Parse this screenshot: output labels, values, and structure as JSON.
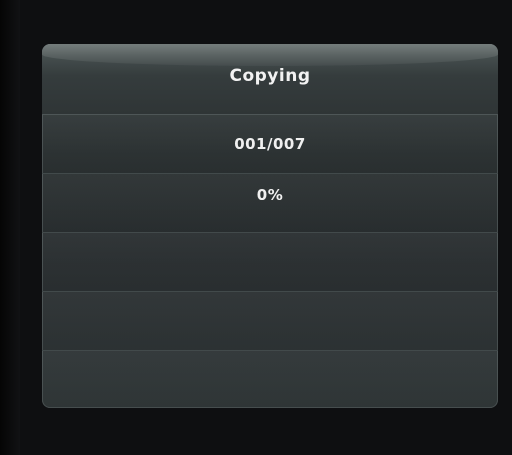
{
  "dialog": {
    "title": "Copying",
    "file_counter": "001/007",
    "progress_percent_text": "0%",
    "progress_percent": 0
  },
  "colors": {
    "background": "#0c0c0d",
    "dialog_body": "#2c3233",
    "dialog_header": "#454e4e",
    "text": "#f2f2f2",
    "divider": "#424a4b"
  }
}
